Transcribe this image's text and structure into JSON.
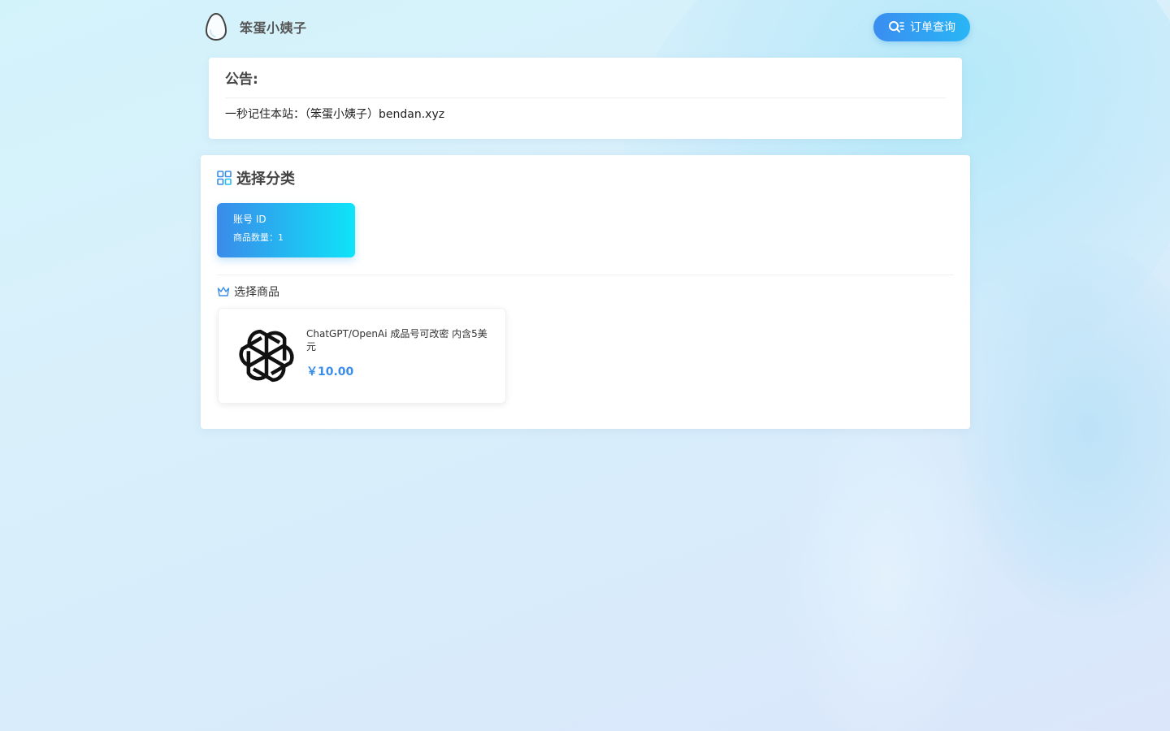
{
  "header": {
    "brand_name": "笨蛋小姨子",
    "order_query_label": "订单查询"
  },
  "notice": {
    "title": "公告:",
    "body": "一秒记住本站：（笨蛋小姨子）bendan.xyz"
  },
  "category_section": {
    "title": "选择分类",
    "categories": [
      {
        "name": "账号 ID",
        "count_text": "商品数量：1"
      }
    ]
  },
  "product_section": {
    "title": "选择商品",
    "products": [
      {
        "name": "ChatGPT/OpenAi 成品号可改密 内含5美元",
        "price": "￥10.00",
        "icon": "openai-logo-icon"
      }
    ]
  },
  "colors": {
    "accent": "#3a8de8",
    "button_gradient_start": "#3a8df0",
    "button_gradient_end": "#29b6f5",
    "category_gradient_start": "#3a8bea",
    "category_gradient_end": "#0fe3f8"
  }
}
